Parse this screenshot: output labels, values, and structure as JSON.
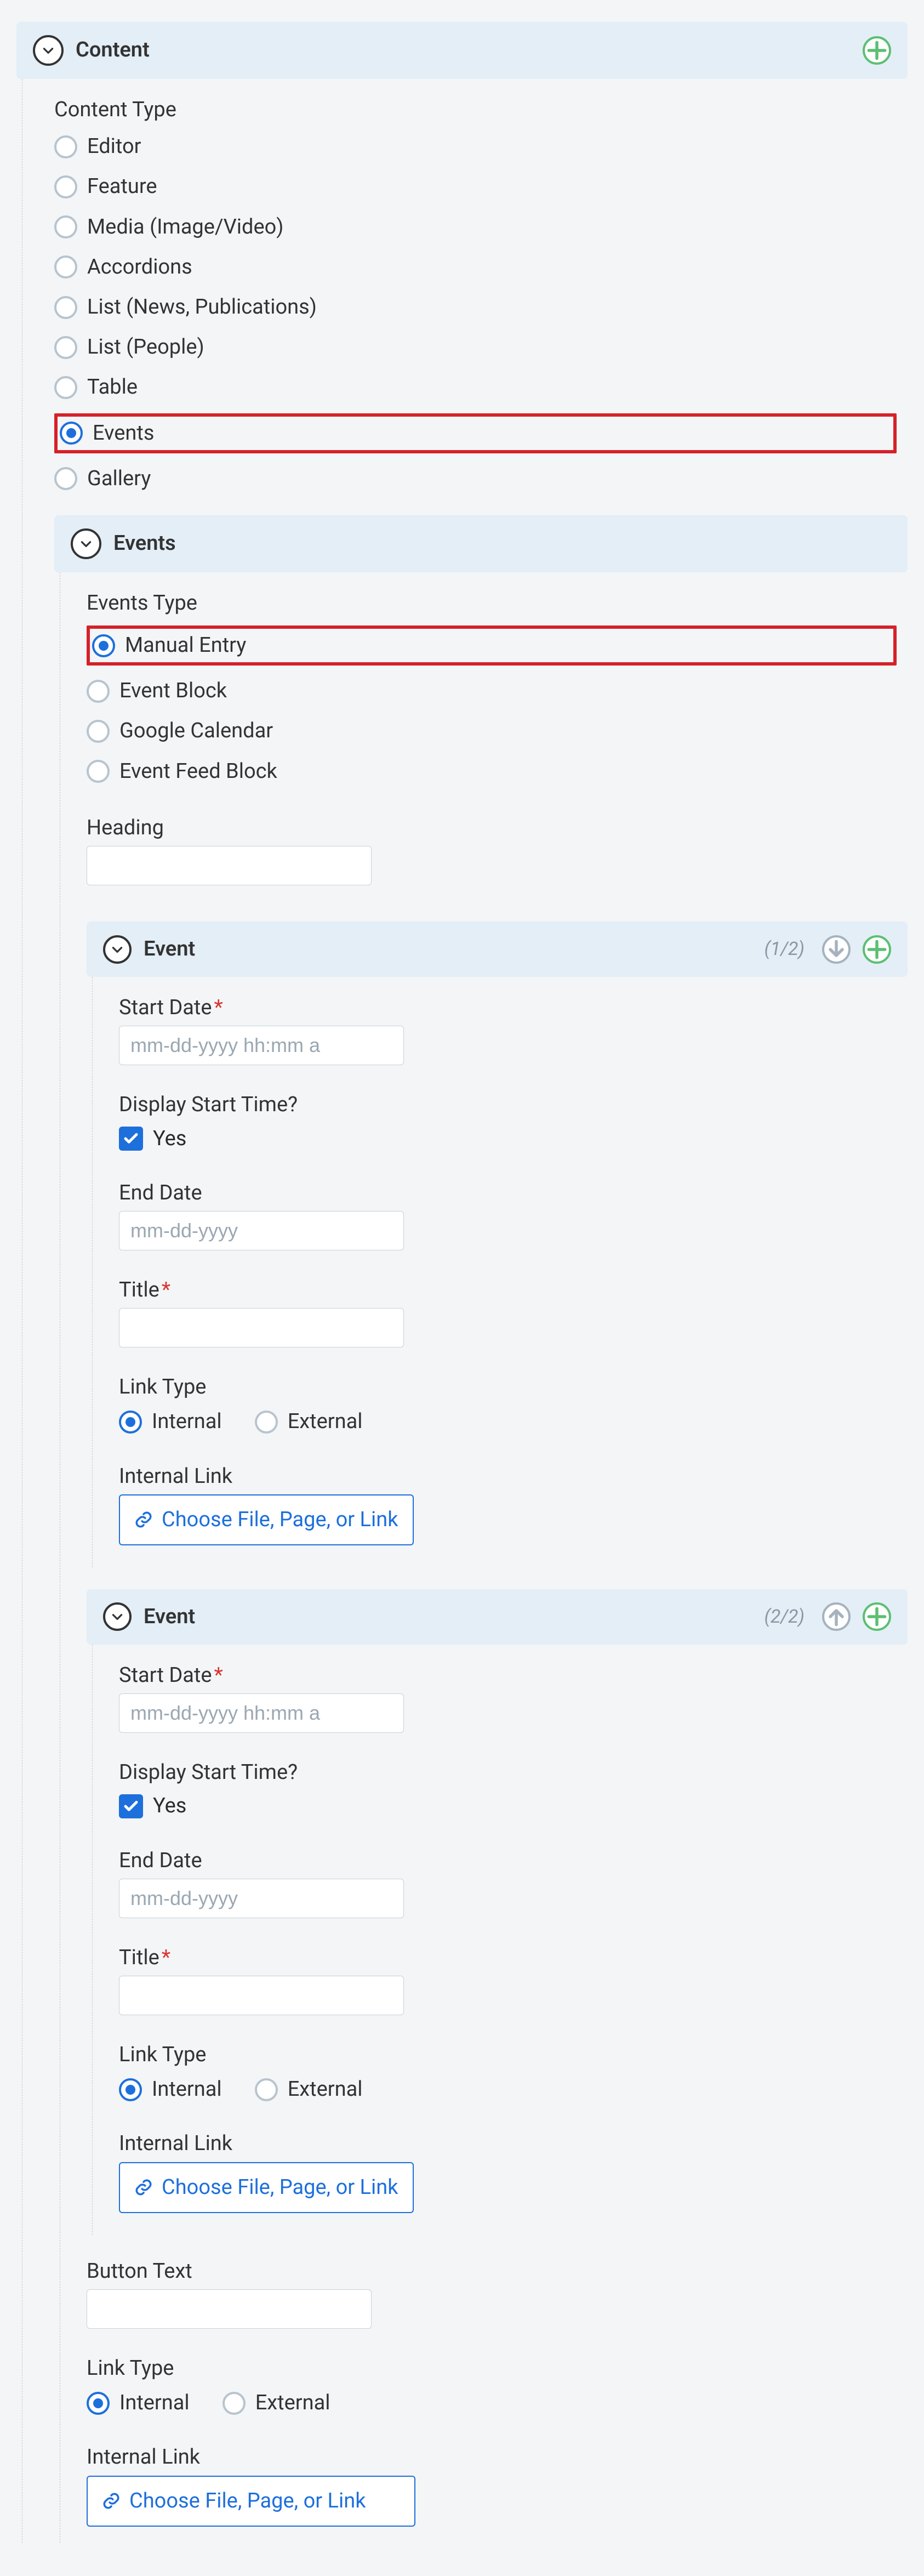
{
  "content": {
    "title": "Content",
    "type_label": "Content Type",
    "options": [
      "Editor",
      "Feature",
      "Media (Image/Video)",
      "Accordions",
      "List (News, Publications)",
      "List (People)",
      "Table",
      "Events",
      "Gallery"
    ],
    "selected": "Events"
  },
  "events": {
    "title": "Events",
    "type_label": "Events Type",
    "options": [
      "Manual Entry",
      "Event Block",
      "Google Calendar",
      "Event Feed Block"
    ],
    "selected": "Manual Entry",
    "heading_label": "Heading",
    "heading_value": "",
    "button_text_label": "Button Text",
    "button_text_value": "",
    "link_type_label": "Link Type",
    "link_type_options": [
      "Internal",
      "External"
    ],
    "link_type_selected": "Internal",
    "internal_link_label": "Internal Link",
    "choose_label": "Choose File, Page, or Link",
    "items": [
      {
        "title": "Event",
        "counter": "(1/2)",
        "start_date_label": "Start Date",
        "start_date_placeholder": "mm-dd-yyyy hh:mm a",
        "display_start_time_label": "Display Start Time?",
        "yes_label": "Yes",
        "end_date_label": "End Date",
        "end_date_placeholder": "mm-dd-yyyy",
        "title_label": "Title",
        "link_type_label": "Link Type",
        "link_type_options": [
          "Internal",
          "External"
        ],
        "link_type_selected": "Internal",
        "internal_link_label": "Internal Link",
        "choose_label": "Choose File, Page, or Link"
      },
      {
        "title": "Event",
        "counter": "(2/2)",
        "start_date_label": "Start Date",
        "start_date_placeholder": "mm-dd-yyyy hh:mm a",
        "display_start_time_label": "Display Start Time?",
        "yes_label": "Yes",
        "end_date_label": "End Date",
        "end_date_placeholder": "mm-dd-yyyy",
        "title_label": "Title",
        "link_type_label": "Link Type",
        "link_type_options": [
          "Internal",
          "External"
        ],
        "link_type_selected": "Internal",
        "internal_link_label": "Internal Link",
        "choose_label": "Choose File, Page, or Link"
      }
    ]
  }
}
